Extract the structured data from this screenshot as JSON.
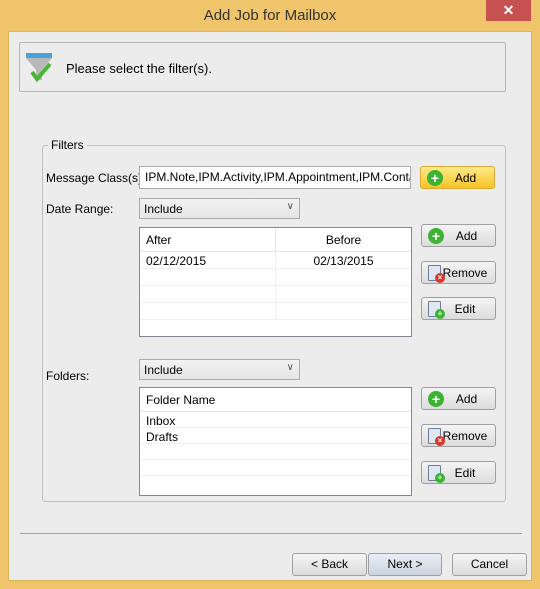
{
  "window": {
    "title": "Add Job for Mailbox",
    "close": "✕"
  },
  "header": {
    "text": "Please select the filter(s).",
    "icon": "funnel-check-icon"
  },
  "filters": {
    "group_label": "Filters",
    "message_class_label": "Message Class(s):",
    "message_class_value": "IPM.Note,IPM.Activity,IPM.Appointment,IPM.Contact,IPM.",
    "message_class_add": "Add",
    "date_range_label": "Date Range:",
    "date_range_mode": "Include",
    "date_columns": [
      "After",
      "Before"
    ],
    "date_rows": [
      [
        "02/12/2015",
        "02/13/2015"
      ]
    ],
    "date_add": "Add",
    "date_remove": "Remove",
    "date_edit": "Edit",
    "folders_label": "Folders:",
    "folders_mode": "Include",
    "folder_column": "Folder Name",
    "folder_rows": [
      "Inbox",
      "Drafts"
    ],
    "folder_add": "Add",
    "folder_remove": "Remove",
    "folder_edit": "Edit"
  },
  "footer": {
    "back": "< Back",
    "next": "Next >",
    "cancel": "Cancel"
  }
}
